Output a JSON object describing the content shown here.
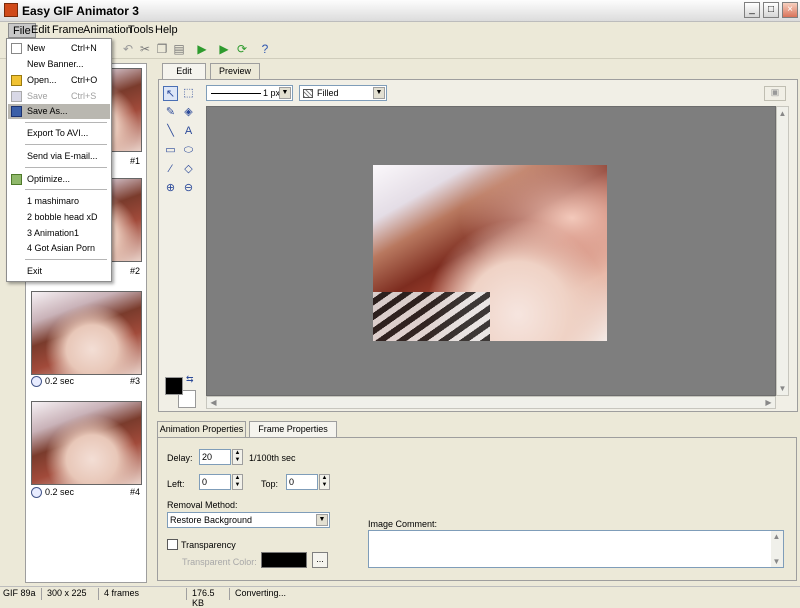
{
  "window": {
    "title": "Easy GIF Animator 3"
  },
  "menubar": {
    "items": [
      "File",
      "Edit",
      "Frame",
      "Animation",
      "Tools",
      "Help"
    ]
  },
  "file_menu": {
    "items": [
      {
        "label": "New",
        "shortcut": "Ctrl+N"
      },
      {
        "label": "New Banner..."
      },
      {
        "label": "Open...",
        "shortcut": "Ctrl+O"
      },
      {
        "label": "Save",
        "shortcut": "Ctrl+S",
        "disabled": true
      },
      {
        "label": "Save As..."
      },
      {
        "label": "Export To AVI..."
      },
      {
        "label": "Send via E-mail..."
      },
      {
        "label": "Optimize..."
      },
      {
        "label": "1 mashimaro"
      },
      {
        "label": "2 bobble head xD"
      },
      {
        "label": "3 Animation1"
      },
      {
        "label": "4 Got Asian Porn"
      },
      {
        "label": "Exit"
      }
    ]
  },
  "frames": [
    {
      "number": "#1",
      "duration": ""
    },
    {
      "number": "#2",
      "duration": ""
    },
    {
      "number": "#3",
      "duration": "0.2 sec"
    },
    {
      "number": "#4",
      "duration": "0.2 sec"
    }
  ],
  "editor": {
    "tabs": [
      "Edit",
      "Preview"
    ],
    "line_width": "1 px",
    "fill_mode": "Filled",
    "tools": [
      "select-arrow",
      "rect-select",
      "pencil",
      "fill-bucket",
      "line",
      "text",
      "rectangle",
      "ellipse",
      "eyedropper",
      "eraser",
      "zoom-in",
      "zoom-out"
    ]
  },
  "properties": {
    "tabs": [
      "Animation Properties",
      "Frame Properties"
    ],
    "delay_label": "Delay:",
    "delay_value": "20",
    "delay_unit": "1/100th sec",
    "left_label": "Left:",
    "left_value": "0",
    "top_label": "Top:",
    "top_value": "0",
    "removal_label": "Removal Method:",
    "removal_value": "Restore Background",
    "transparency_label": "Transparency",
    "transparent_color_label": "Transparent Color:",
    "browse_label": "...",
    "comment_label": "Image Comment:",
    "comment_value": ""
  },
  "status": {
    "format": "GIF 89a",
    "dimensions": "300 x 225",
    "frames": "4 frames",
    "size": "176.5 KB",
    "message": "Converting..."
  },
  "colors": {
    "canvas_bg": "#7e7e7e",
    "primary_color": "#000000",
    "secondary_color": "#ffffff",
    "transparent_color": "#000000"
  }
}
